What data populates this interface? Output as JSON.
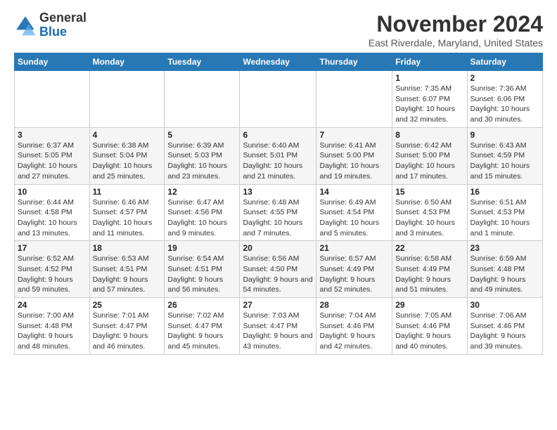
{
  "logo": {
    "general": "General",
    "blue": "Blue"
  },
  "header": {
    "title": "November 2024",
    "location": "East Riverdale, Maryland, United States"
  },
  "weekdays": [
    "Sunday",
    "Monday",
    "Tuesday",
    "Wednesday",
    "Thursday",
    "Friday",
    "Saturday"
  ],
  "weeks": [
    [
      {
        "day": "",
        "info": ""
      },
      {
        "day": "",
        "info": ""
      },
      {
        "day": "",
        "info": ""
      },
      {
        "day": "",
        "info": ""
      },
      {
        "day": "",
        "info": ""
      },
      {
        "day": "1",
        "info": "Sunrise: 7:35 AM\nSunset: 6:07 PM\nDaylight: 10 hours and 32 minutes."
      },
      {
        "day": "2",
        "info": "Sunrise: 7:36 AM\nSunset: 6:06 PM\nDaylight: 10 hours and 30 minutes."
      }
    ],
    [
      {
        "day": "3",
        "info": "Sunrise: 6:37 AM\nSunset: 5:05 PM\nDaylight: 10 hours and 27 minutes."
      },
      {
        "day": "4",
        "info": "Sunrise: 6:38 AM\nSunset: 5:04 PM\nDaylight: 10 hours and 25 minutes."
      },
      {
        "day": "5",
        "info": "Sunrise: 6:39 AM\nSunset: 5:03 PM\nDaylight: 10 hours and 23 minutes."
      },
      {
        "day": "6",
        "info": "Sunrise: 6:40 AM\nSunset: 5:01 PM\nDaylight: 10 hours and 21 minutes."
      },
      {
        "day": "7",
        "info": "Sunrise: 6:41 AM\nSunset: 5:00 PM\nDaylight: 10 hours and 19 minutes."
      },
      {
        "day": "8",
        "info": "Sunrise: 6:42 AM\nSunset: 5:00 PM\nDaylight: 10 hours and 17 minutes."
      },
      {
        "day": "9",
        "info": "Sunrise: 6:43 AM\nSunset: 4:59 PM\nDaylight: 10 hours and 15 minutes."
      }
    ],
    [
      {
        "day": "10",
        "info": "Sunrise: 6:44 AM\nSunset: 4:58 PM\nDaylight: 10 hours and 13 minutes."
      },
      {
        "day": "11",
        "info": "Sunrise: 6:46 AM\nSunset: 4:57 PM\nDaylight: 10 hours and 11 minutes."
      },
      {
        "day": "12",
        "info": "Sunrise: 6:47 AM\nSunset: 4:56 PM\nDaylight: 10 hours and 9 minutes."
      },
      {
        "day": "13",
        "info": "Sunrise: 6:48 AM\nSunset: 4:55 PM\nDaylight: 10 hours and 7 minutes."
      },
      {
        "day": "14",
        "info": "Sunrise: 6:49 AM\nSunset: 4:54 PM\nDaylight: 10 hours and 5 minutes."
      },
      {
        "day": "15",
        "info": "Sunrise: 6:50 AM\nSunset: 4:53 PM\nDaylight: 10 hours and 3 minutes."
      },
      {
        "day": "16",
        "info": "Sunrise: 6:51 AM\nSunset: 4:53 PM\nDaylight: 10 hours and 1 minute."
      }
    ],
    [
      {
        "day": "17",
        "info": "Sunrise: 6:52 AM\nSunset: 4:52 PM\nDaylight: 9 hours and 59 minutes."
      },
      {
        "day": "18",
        "info": "Sunrise: 6:53 AM\nSunset: 4:51 PM\nDaylight: 9 hours and 57 minutes."
      },
      {
        "day": "19",
        "info": "Sunrise: 6:54 AM\nSunset: 4:51 PM\nDaylight: 9 hours and 56 minutes."
      },
      {
        "day": "20",
        "info": "Sunrise: 6:56 AM\nSunset: 4:50 PM\nDaylight: 9 hours and 54 minutes."
      },
      {
        "day": "21",
        "info": "Sunrise: 6:57 AM\nSunset: 4:49 PM\nDaylight: 9 hours and 52 minutes."
      },
      {
        "day": "22",
        "info": "Sunrise: 6:58 AM\nSunset: 4:49 PM\nDaylight: 9 hours and 51 minutes."
      },
      {
        "day": "23",
        "info": "Sunrise: 6:59 AM\nSunset: 4:48 PM\nDaylight: 9 hours and 49 minutes."
      }
    ],
    [
      {
        "day": "24",
        "info": "Sunrise: 7:00 AM\nSunset: 4:48 PM\nDaylight: 9 hours and 48 minutes."
      },
      {
        "day": "25",
        "info": "Sunrise: 7:01 AM\nSunset: 4:47 PM\nDaylight: 9 hours and 46 minutes."
      },
      {
        "day": "26",
        "info": "Sunrise: 7:02 AM\nSunset: 4:47 PM\nDaylight: 9 hours and 45 minutes."
      },
      {
        "day": "27",
        "info": "Sunrise: 7:03 AM\nSunset: 4:47 PM\nDaylight: 9 hours and 43 minutes."
      },
      {
        "day": "28",
        "info": "Sunrise: 7:04 AM\nSunset: 4:46 PM\nDaylight: 9 hours and 42 minutes."
      },
      {
        "day": "29",
        "info": "Sunrise: 7:05 AM\nSunset: 4:46 PM\nDaylight: 9 hours and 40 minutes."
      },
      {
        "day": "30",
        "info": "Sunrise: 7:06 AM\nSunset: 4:46 PM\nDaylight: 9 hours and 39 minutes."
      }
    ]
  ]
}
